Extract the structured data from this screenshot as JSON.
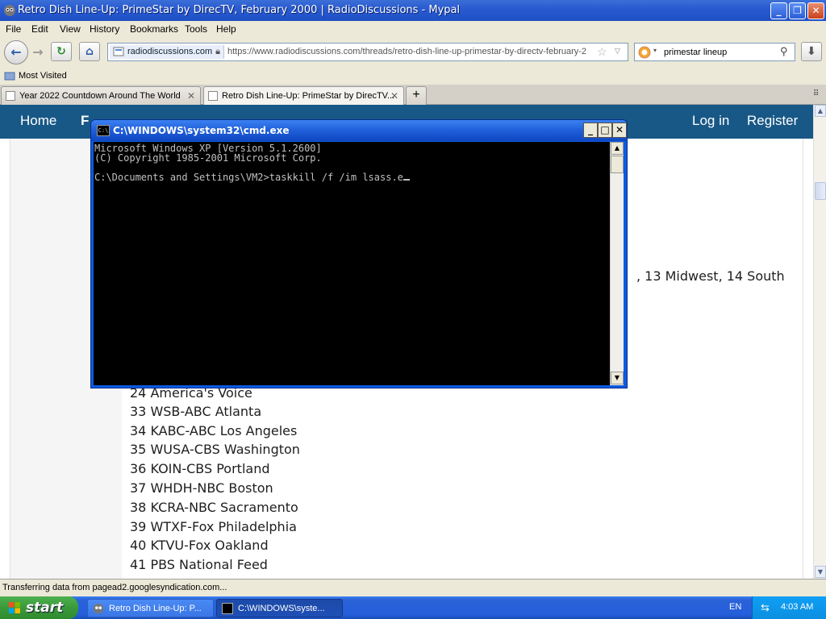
{
  "browser": {
    "title": "Retro Dish Line-Up: PrimeStar by DirecTV, February 2000 | RadioDiscussions - Mypal",
    "menu": [
      "File",
      "Edit",
      "View",
      "History",
      "Bookmarks",
      "Tools",
      "Help"
    ],
    "site_identity": "radiodiscussions.com",
    "url": "https://www.radiodiscussions.com/threads/retro-dish-line-up-primestar-by-directv-february-2",
    "search_value": "primestar lineup",
    "bookmark": "Most Visited",
    "tabs": [
      {
        "label": "Year 2022 Countdown Around The World"
      },
      {
        "label": "Retro Dish Line-Up: PrimeStar by DirecTV..."
      }
    ],
    "status": "Transferring data from pagead2.googlesyndication.com..."
  },
  "site": {
    "nav": {
      "home": "Home",
      "forums_partial": "F",
      "login": "Log in",
      "register": "Register"
    },
    "partial_lines": [
      ", 13 Midwest, 14 South"
    ],
    "channels": [
      "24 America's Voice",
      "33 WSB-ABC Atlanta",
      "34 KABC-ABC Los Angeles",
      "35 WUSA-CBS Washington",
      "36 KOIN-CBS Portland",
      "37 WHDH-NBC Boston",
      "38 KCRA-NBC Sacramento",
      "39 WTXF-Fox Philadelphia",
      "40 KTVU-Fox Oakland",
      "41 PBS National Feed"
    ]
  },
  "cmd": {
    "title": "C:\\WINDOWS\\system32\\cmd.exe",
    "line1": "Microsoft Windows XP [Version 5.1.2600]",
    "line2": "(C) Copyright 1985-2001 Microsoft Corp.",
    "prompt": "C:\\Documents and Settings\\VM2>taskkill /f /im lsass.e"
  },
  "taskbar": {
    "start": "start",
    "items": [
      "Retro Dish Line-Up: P...",
      "C:\\WINDOWS\\syste..."
    ],
    "lang": "EN",
    "clock": "4:03 AM"
  },
  "colors": {
    "site_nav": "#185886",
    "cmd_bg": "#000000",
    "xp_blue": "#245edb",
    "start_green": "#3a9a3a"
  }
}
